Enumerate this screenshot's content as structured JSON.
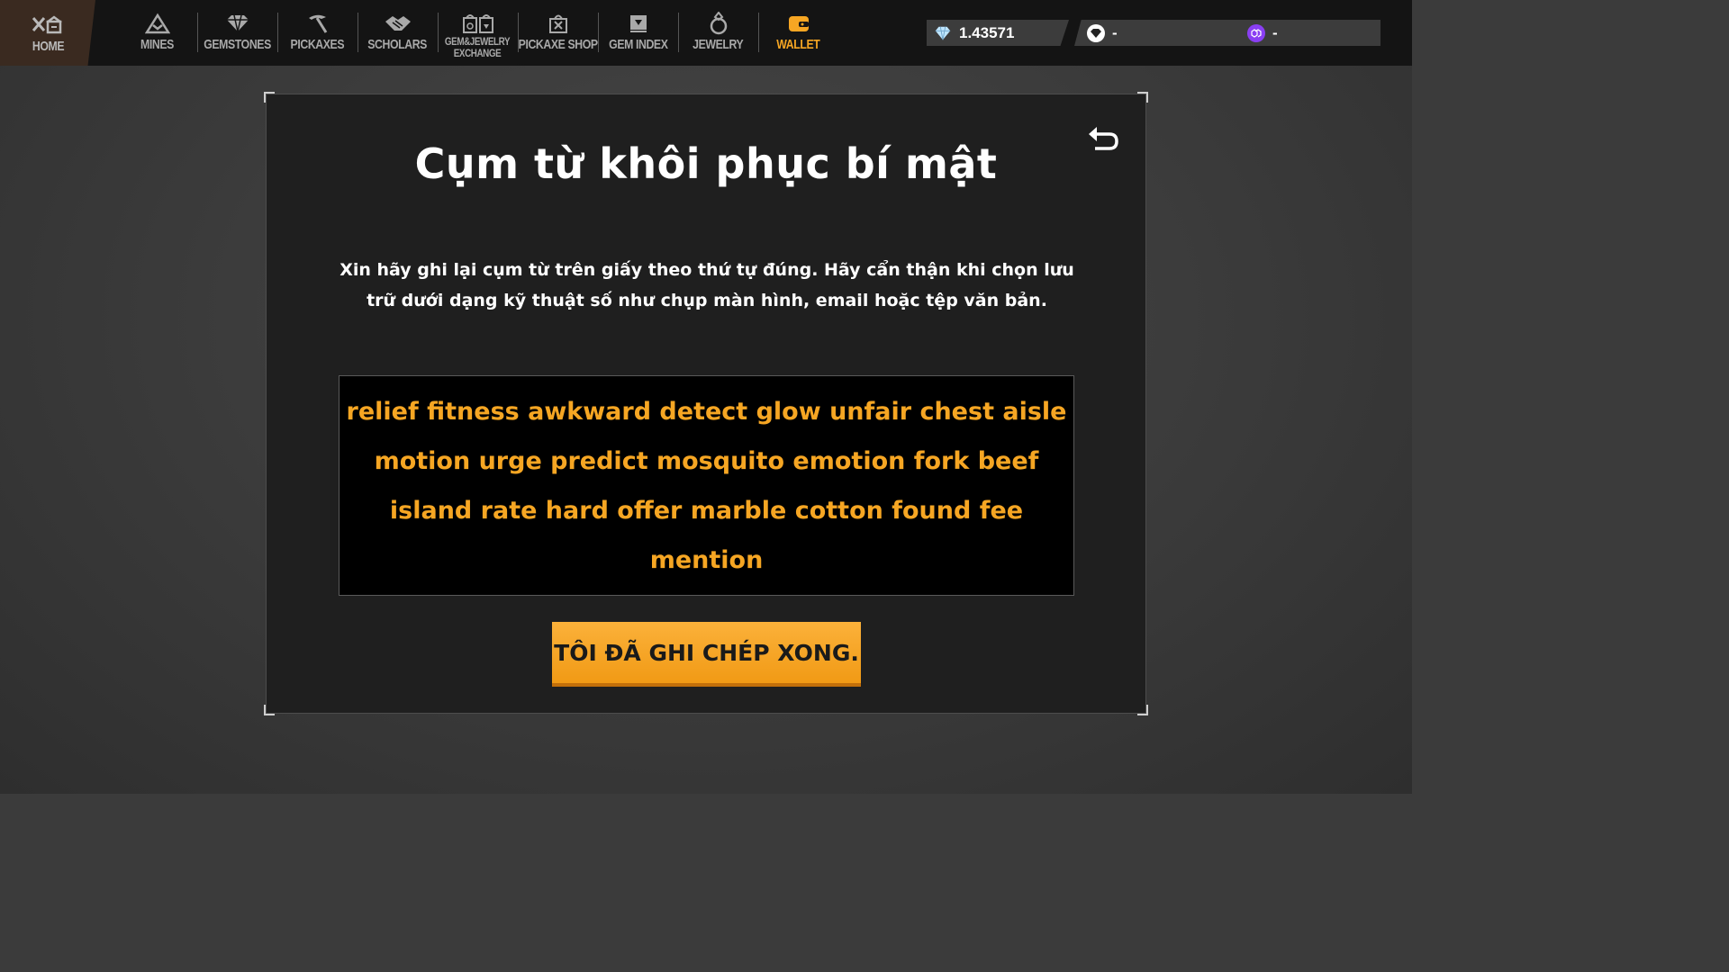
{
  "nav": {
    "home": {
      "label": "HOME",
      "icon": "home-icon"
    },
    "items": [
      {
        "label": "MINES",
        "icon": "mountain-icon"
      },
      {
        "label": "GEMSTONES",
        "icon": "gem-icon"
      },
      {
        "label": "PICKAXES",
        "icon": "pickaxe-icon"
      },
      {
        "label": "SCHOLARS",
        "icon": "handshake-icon"
      },
      {
        "label_line1": "GEM&JEWELRY",
        "label_line2": "EXCHANGE",
        "icon": "exchange-icon"
      },
      {
        "label": "PICKAXE SHOP",
        "icon": "shop-bag-icon"
      },
      {
        "label": "GEM INDEX",
        "icon": "index-card-icon"
      },
      {
        "label": "JEWELRY",
        "icon": "ring-icon"
      },
      {
        "label": "WALLET",
        "icon": "wallet-icon",
        "active": true
      }
    ]
  },
  "balances": [
    {
      "value": "1.43571",
      "icon": "diamond-coin-icon"
    },
    {
      "value": "-",
      "icon": "gem-token-icon"
    },
    {
      "value": "-",
      "icon": "polygon-token-icon"
    }
  ],
  "modal": {
    "title": "Cụm từ khôi phục bí mật",
    "description": "Xin hãy ghi lại cụm từ trên giấy theo thứ tự đúng. Hãy cẩn thận khi chọn lưu trữ dưới dạng kỹ thuật số như chụp màn hình, email hoặc tệp văn bản.",
    "phrase": "relief fitness awkward detect glow unfair chest aisle motion urge predict mosquito emotion fork beef island rate hard offer marble cotton found fee mention",
    "done_button": "TÔI ĐÃ GHI CHÉP XONG.",
    "back_icon": "undo-arrow-icon"
  },
  "colors": {
    "accent": "#f6a623",
    "nav_bg": "#141414",
    "modal_bg": "#1f1f1f"
  }
}
